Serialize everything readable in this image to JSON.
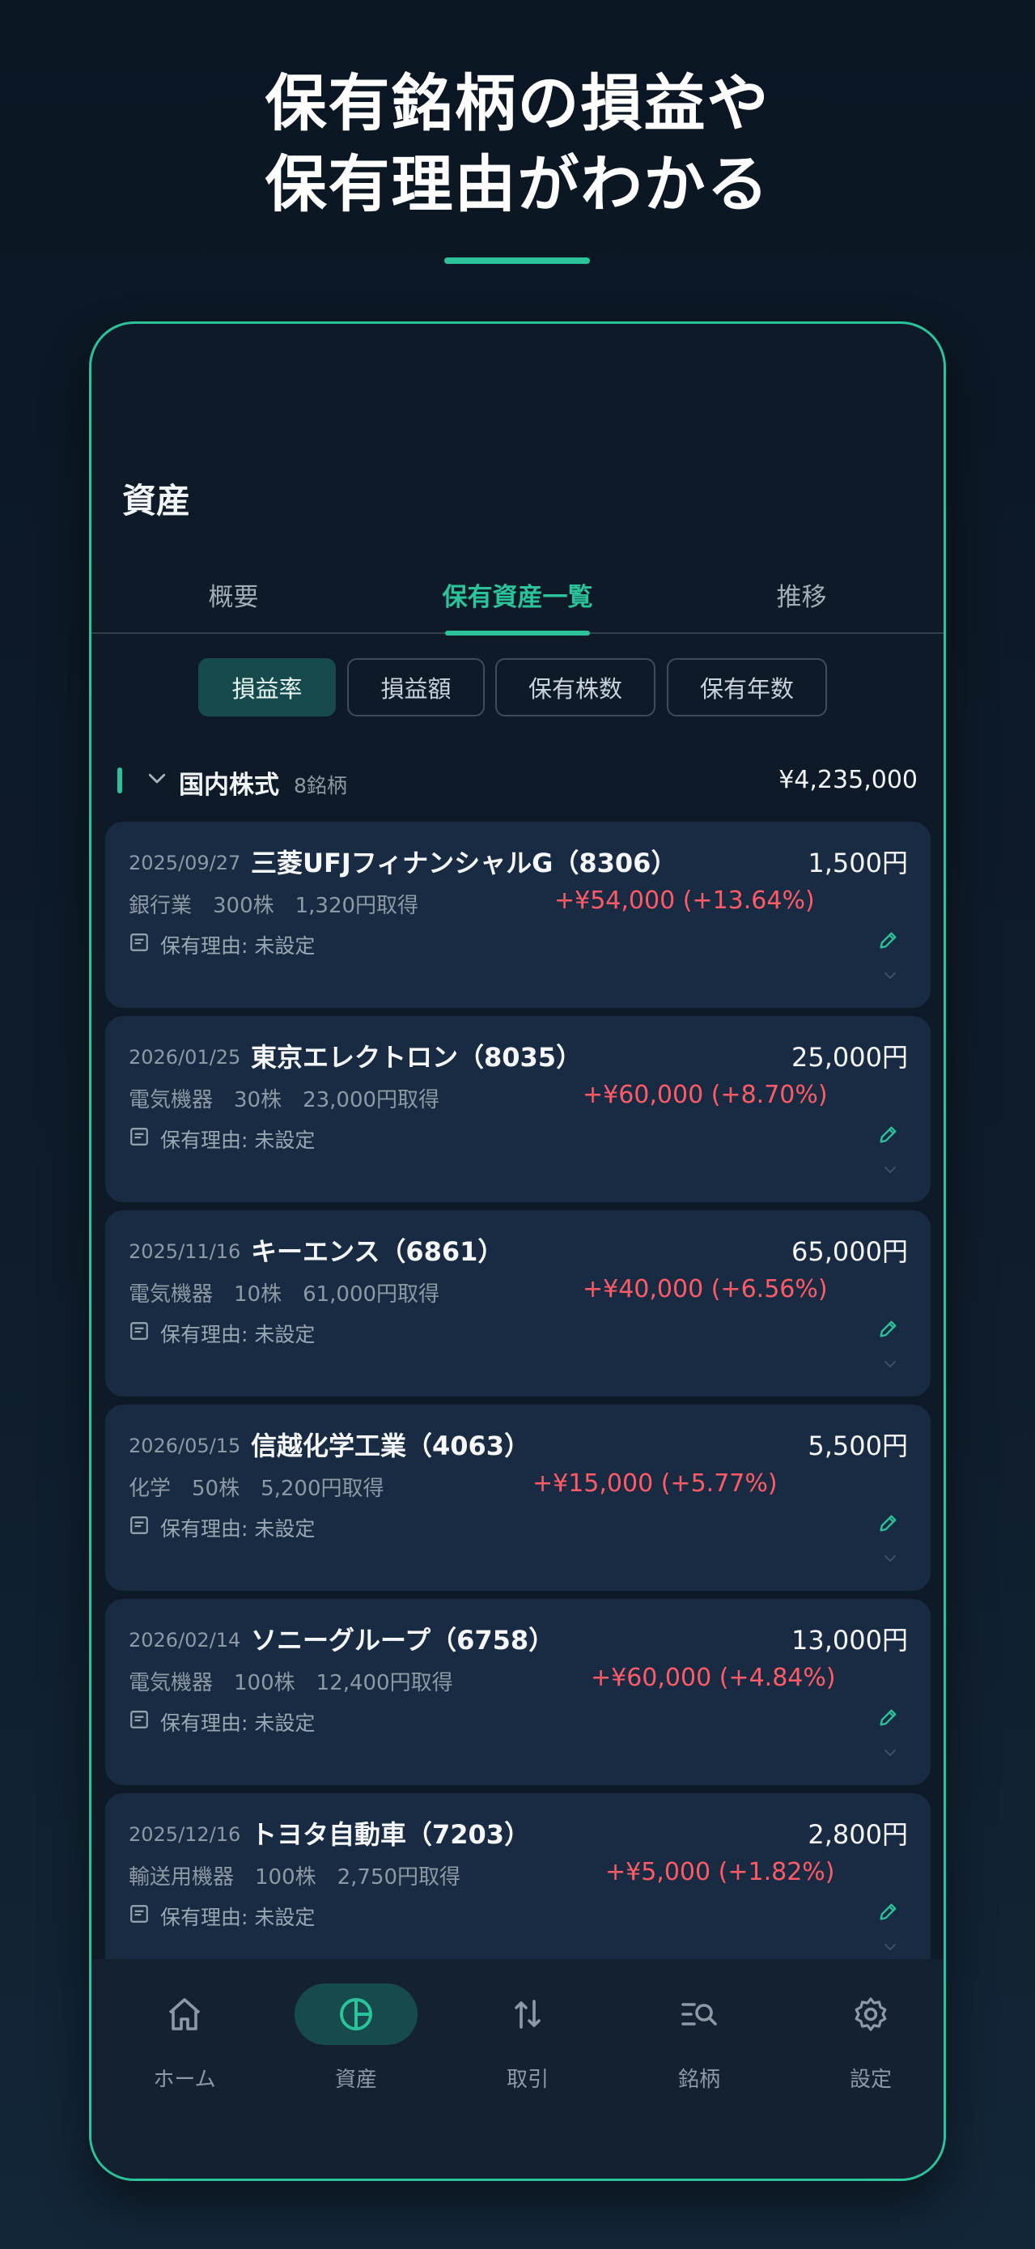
{
  "headline": {
    "line1": "保有銘柄の損益や",
    "line2": "保有理由がわかる"
  },
  "screen": {
    "title": "資産",
    "tabs": [
      "概要",
      "保有資産一覧",
      "推移"
    ],
    "active_tab": "保有資産一覧",
    "sort_chips": [
      "損益率",
      "損益額",
      "保有株数",
      "保有年数"
    ],
    "selected_chip": "損益率"
  },
  "section": {
    "title": "国内株式",
    "count": "8銘柄",
    "total": "¥4,235,000"
  },
  "holdings": [
    {
      "date": "2025/09/27",
      "name": "三菱UFJフィナンシャルG（8306）",
      "price": "1,500円",
      "meta": "銀行業　300株　1,320円取得",
      "pnl": "+¥54,000 (+13.64%)",
      "memo": "保有理由: 未設定"
    },
    {
      "date": "2026/01/25",
      "name": "東京エレクトロン（8035）",
      "price": "25,000円",
      "meta": "電気機器　30株　23,000円取得",
      "pnl": "+¥60,000 (+8.70%)",
      "memo": "保有理由: 未設定"
    },
    {
      "date": "2025/11/16",
      "name": "キーエンス（6861）",
      "price": "65,000円",
      "meta": "電気機器　10株　61,000円取得",
      "pnl": "+¥40,000 (+6.56%)",
      "memo": "保有理由: 未設定"
    },
    {
      "date": "2026/05/15",
      "name": "信越化学工業（4063）",
      "price": "5,500円",
      "meta": "化学　50株　5,200円取得",
      "pnl": "+¥15,000 (+5.77%)",
      "memo": "保有理由: 未設定"
    },
    {
      "date": "2026/02/14",
      "name": "ソニーグループ（6758）",
      "price": "13,000円",
      "meta": "電気機器　100株　12,400円取得",
      "pnl": "+¥60,000 (+4.84%)",
      "memo": "保有理由: 未設定"
    },
    {
      "date": "2025/12/16",
      "name": "トヨタ自動車（7203）",
      "price": "2,800円",
      "meta": "輸送用機器　100株　2,750円取得",
      "pnl": "+¥5,000 (+1.82%)",
      "memo": "保有理由: 未設定"
    }
  ],
  "bottom_nav": [
    {
      "label": "ホーム",
      "icon": "home-icon"
    },
    {
      "label": "資産",
      "icon": "pie-chart-icon"
    },
    {
      "label": "取引",
      "icon": "swap-vertical-icon"
    },
    {
      "label": "銘柄",
      "icon": "search-list-icon"
    },
    {
      "label": "設定",
      "icon": "gear-icon"
    }
  ],
  "active_nav": "資産",
  "colors": {
    "accent": "#2bc49a",
    "gain": "#ff5b66",
    "card_bg": "#182b43",
    "selected_bg": "#164a4d"
  }
}
